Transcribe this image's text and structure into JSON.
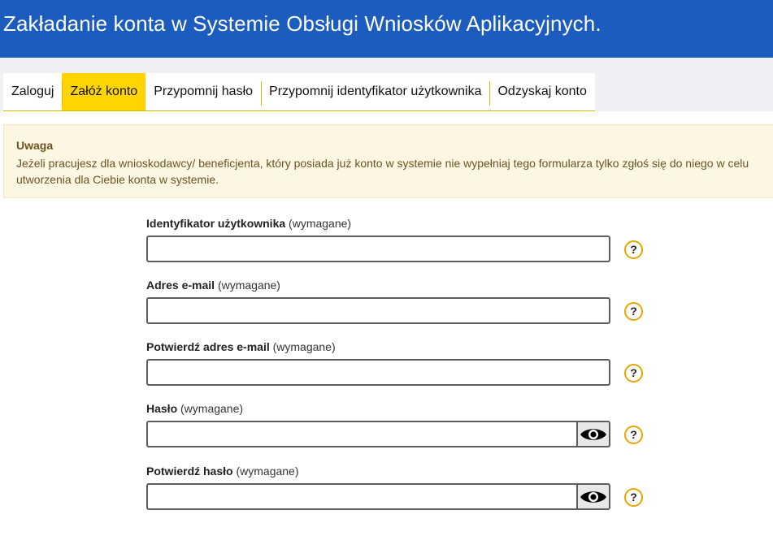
{
  "header": {
    "title": "Zakładanie konta w Systemie Obsługi Wniosków Aplikacyjnych."
  },
  "tabs": [
    {
      "label": "Zaloguj"
    },
    {
      "label": "Załóż konto",
      "active": true
    },
    {
      "label": "Przypomnij hasło"
    },
    {
      "label": "Przypomnij identyfikator użytkownika"
    },
    {
      "label": "Odzyskaj konto"
    }
  ],
  "notice": {
    "title": "Uwaga",
    "text": "Jeżeli pracujesz dla wnioskodawcy/ beneficjenta, który posiada już konto w systemie nie wypełniaj tego formularza tylko zgłoś się do niego w celu utworzenia dla Ciebie konta w systemie."
  },
  "form": {
    "required_suffix": "(wymagane)",
    "help_symbol": "?",
    "fields": [
      {
        "label": "Identyfikator użytkownika",
        "value": "",
        "type": "text"
      },
      {
        "label": "Adres e-mail",
        "value": "",
        "type": "text"
      },
      {
        "label": "Potwierdź adres e-mail",
        "value": "",
        "type": "text"
      },
      {
        "label": "Hasło",
        "value": "",
        "type": "password",
        "toggle_icon": "eye-icon"
      },
      {
        "label": "Potwierdź hasło",
        "value": "",
        "type": "password",
        "toggle_icon": "eye-icon"
      }
    ]
  },
  "colors": {
    "header_bg": "#1c5cbf",
    "active_tab_bg": "#ffd400",
    "notice_bg": "#fdf6e3",
    "help_border": "#e6a800"
  }
}
